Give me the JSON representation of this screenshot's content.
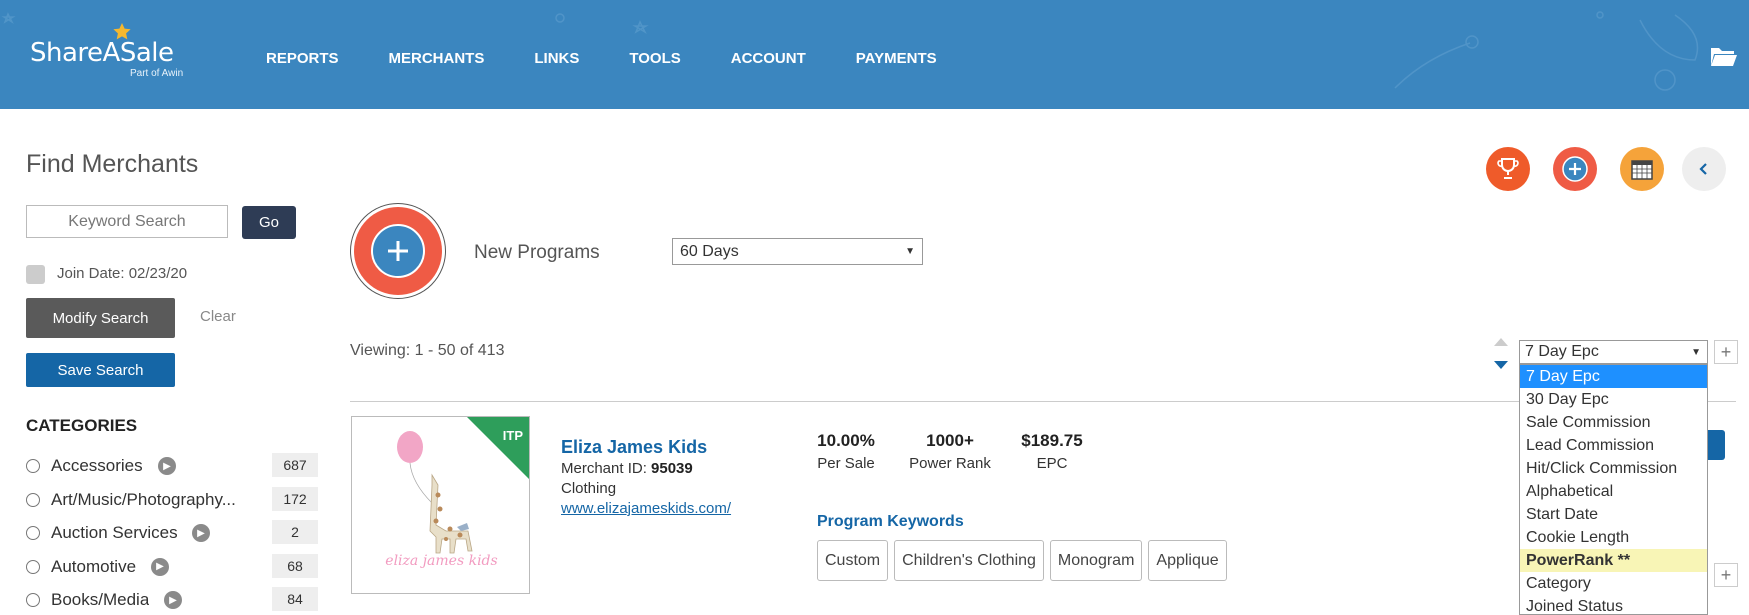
{
  "brand": {
    "name": "ShareASale",
    "sub": "Part of Awin",
    "header_color": "#3b86bf"
  },
  "nav": {
    "items": [
      {
        "label": "REPORTS"
      },
      {
        "label": "MERCHANTS"
      },
      {
        "label": "LINKS"
      },
      {
        "label": "TOOLS"
      },
      {
        "label": "ACCOUNT"
      },
      {
        "label": "PAYMENTS"
      }
    ]
  },
  "sidebar": {
    "title": "Find Merchants",
    "keyword_placeholder": "Keyword Search",
    "go_label": "Go",
    "join_date_label": "Join Date: 02/23/20",
    "modify_label": "Modify Search",
    "clear_label": "Clear",
    "save_label": "Save Search",
    "categories_title": "CATEGORIES",
    "categories": [
      {
        "name": "Accessories",
        "count": "687",
        "arrow": true
      },
      {
        "name": "Art/Music/Photography...",
        "count": "172",
        "arrow": false
      },
      {
        "name": "Auction Services",
        "count": "2",
        "arrow": true
      },
      {
        "name": "Automotive",
        "count": "68",
        "arrow": true
      },
      {
        "name": "Books/Media",
        "count": "84",
        "arrow": true
      }
    ]
  },
  "main": {
    "new_programs_label": "New Programs",
    "days_select": "60 Days",
    "viewing": "Viewing: 1 - 50 of 413",
    "sort": {
      "selected": "7 Day Epc",
      "options": [
        {
          "label": "7 Day Epc",
          "state": "active"
        },
        {
          "label": "30 Day Epc",
          "state": ""
        },
        {
          "label": "Sale Commission",
          "state": ""
        },
        {
          "label": "Lead Commission",
          "state": ""
        },
        {
          "label": "Hit/Click Commission",
          "state": ""
        },
        {
          "label": "Alphabetical",
          "state": ""
        },
        {
          "label": "Start Date",
          "state": ""
        },
        {
          "label": "Cookie Length",
          "state": ""
        },
        {
          "label": "PowerRank **",
          "state": "hl"
        },
        {
          "label": "Category",
          "state": ""
        },
        {
          "label": "Joined Status",
          "state": ""
        }
      ]
    },
    "plus_label": "+"
  },
  "merchant": {
    "badge": "ITP",
    "name": "Eliza James Kids",
    "id_label": "Merchant ID: ",
    "id_value": "95039",
    "category": "Clothing",
    "url": "www.elizajameskids.com/",
    "logo_text": "eliza james kids",
    "stats": [
      {
        "value": "10.00%",
        "label": "Per Sale"
      },
      {
        "value": "1000+",
        "label": "Power Rank"
      },
      {
        "value": "$189.75",
        "label": "EPC"
      }
    ],
    "keywords_title": "Program Keywords",
    "keywords": [
      "Custom",
      "Children's Clothing",
      "Monogram",
      "Applique"
    ]
  }
}
